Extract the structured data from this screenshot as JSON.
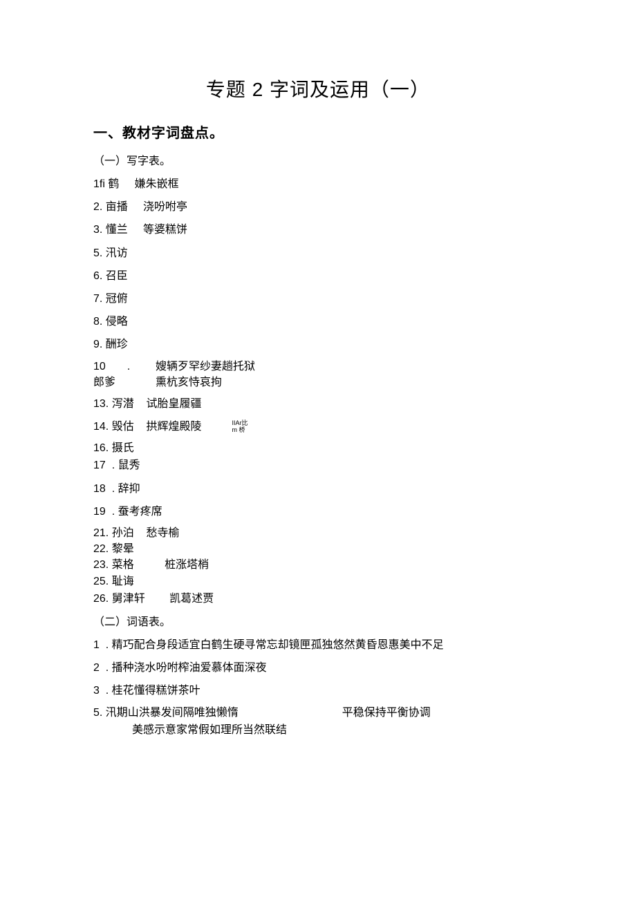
{
  "title": "专题 2 字词及运用（一）",
  "section1": {
    "heading": "一、教材字词盘点。",
    "sub1": "（一）写字表。",
    "lines_a": [
      "1fi 鹤     嫌朱嵌框",
      "2. 亩播     浇吩咐亭",
      "3. 懂兰     等婆糕饼",
      "5. 汛访",
      "6. 召臣",
      "7. 冠俯",
      "8. 侵略",
      "9. 酬珍"
    ],
    "group10": {
      "left_top": "10       .",
      "left_bot": "郎爹",
      "right_top": "嫂辆歹罕纱妻趟托狱",
      "right_bot": "熏杭亥恃哀拘"
    },
    "lines_b": [
      "13. 泻潜    试胎皇履疆"
    ],
    "line14": {
      "main": "14. 毁估    拱辉煌殿陵",
      "small_top": "IIAr比",
      "small_bot": "m 桥"
    },
    "lines_c": [
      "16. 摄氏",
      "17  . 鼠秀",
      "18  . 辞抑",
      "19  . 蚕考疼席",
      "21. 孙泊    愁寺榆",
      "22. 黎晕",
      "23. 菜格          桩涨塔梢",
      "25. 耻诲",
      "26. 舅津轩        凯葛述贾"
    ],
    "sub2": "（二）词语表。",
    "lines_d": [
      "1  . 精巧配合身段适宜白鹤生硬寻常忘却镜匣孤独悠然黄昏恩惠美中不足",
      "2  . 播种浇水吩咐榨油爱慕体面深夜",
      "3  . 桂花懂得糕饼茶叶"
    ],
    "line5": {
      "left": "5. 汛期山洪暴发间隔唯独懒惰",
      "right": "平稳保持平衡协调"
    },
    "lastline": "美感示意家常假如理所当然联结"
  }
}
